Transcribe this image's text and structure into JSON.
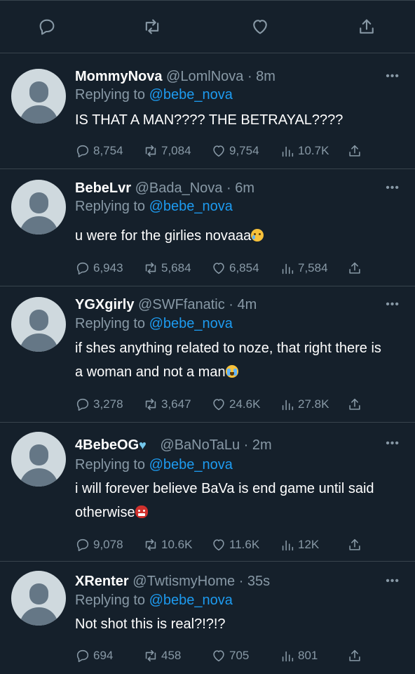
{
  "top_actions": {
    "reply_icon": "reply-icon",
    "retweet_icon": "retweet-icon",
    "like_icon": "like-icon",
    "share_icon": "share-icon"
  },
  "colors": {
    "background": "#15202b",
    "divider": "#38444d",
    "muted": "#8899a6",
    "mention": "#1d9bf0"
  },
  "replies": [
    {
      "display_name": "MommyNova",
      "handle_meta": "@LomlNova · 8m",
      "replying_label": "Replying to",
      "replying_to": "@bebe_nova",
      "text": "IS THAT A MAN???? THE BETRAYAL????",
      "emoji": "",
      "replies": "8,754",
      "retweets": "7,084",
      "likes": "9,754",
      "views": "10.7K"
    },
    {
      "display_name": "BebeLvr",
      "handle_meta": "@Bada_Nova · 6m",
      "replying_label": "Replying to",
      "replying_to": "@bebe_nova",
      "text": "u were for the girlies novaaa",
      "emoji": "sad-tear-emoji",
      "replies": "6,943",
      "retweets": "5,684",
      "likes": "6,854",
      "views": "7,584"
    },
    {
      "display_name": "YGXgirly",
      "handle_meta": "@SWFfanatic · 4m",
      "replying_label": "Replying to",
      "replying_to": "@bebe_nova",
      "text": "if shes anything related to noze, that right there is a woman and not a man",
      "emoji": "loudly-crying-emoji",
      "replies": "3,278",
      "retweets": "3,647",
      "likes": "24.6K",
      "views": "27.8K"
    },
    {
      "display_name": "4BebeOG",
      "name_emoji": "light-blue-heart-emoji",
      "handle_meta": "@BaNoTaLu · 2m",
      "replying_label": "Replying to",
      "replying_to": "@bebe_nova",
      "text": "i will forever believe BaVa is end game until said otherwise",
      "emoji": "ogre-emoji",
      "replies": "9,078",
      "retweets": "10.6K",
      "likes": "11.6K",
      "views": "12K"
    },
    {
      "display_name": "XRenter",
      "handle_meta": "@TwtismyHome · 35s",
      "replying_label": "Replying to",
      "replying_to": "@bebe_nova",
      "text": "Not shot this is real?!?!?",
      "emoji": "",
      "replies": "694",
      "retweets": "458",
      "likes": "705",
      "views": "801"
    }
  ]
}
